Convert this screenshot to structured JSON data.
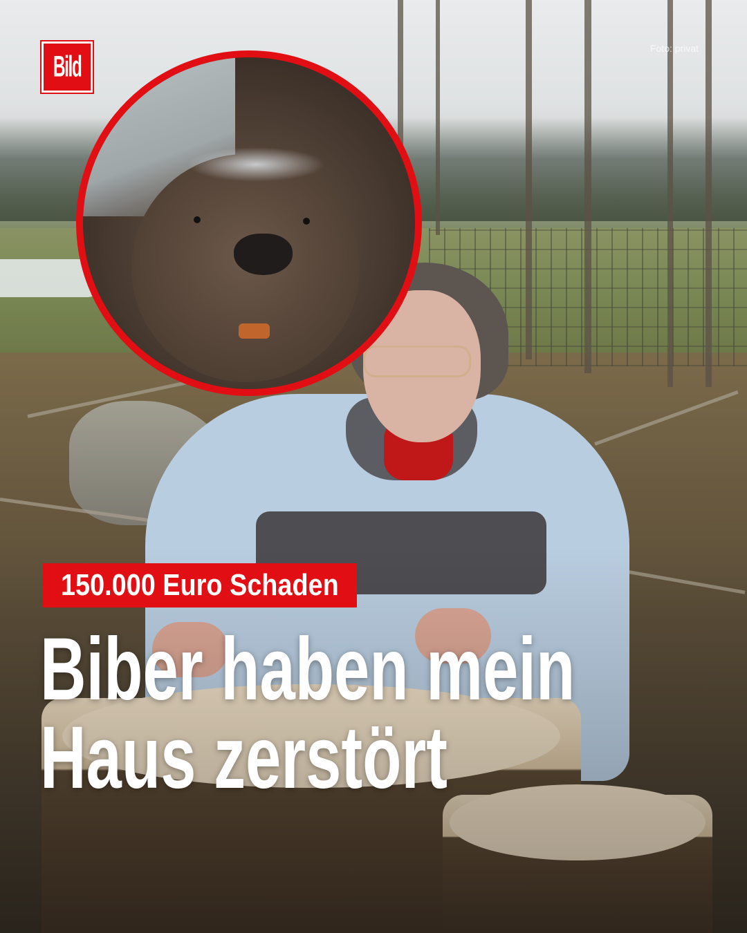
{
  "brand": {
    "logo_text": "Bild",
    "color_red": "#e10e13"
  },
  "image_credit": "Foto: privat",
  "tag": {
    "text": "150.000 Euro Schaden"
  },
  "headline": {
    "line1": "Biber haben mein",
    "line2": "Haus zerstört"
  },
  "photo": {
    "inset_subject": "beaver",
    "main_subject": "elderly woman with gnawed tree stumps"
  }
}
